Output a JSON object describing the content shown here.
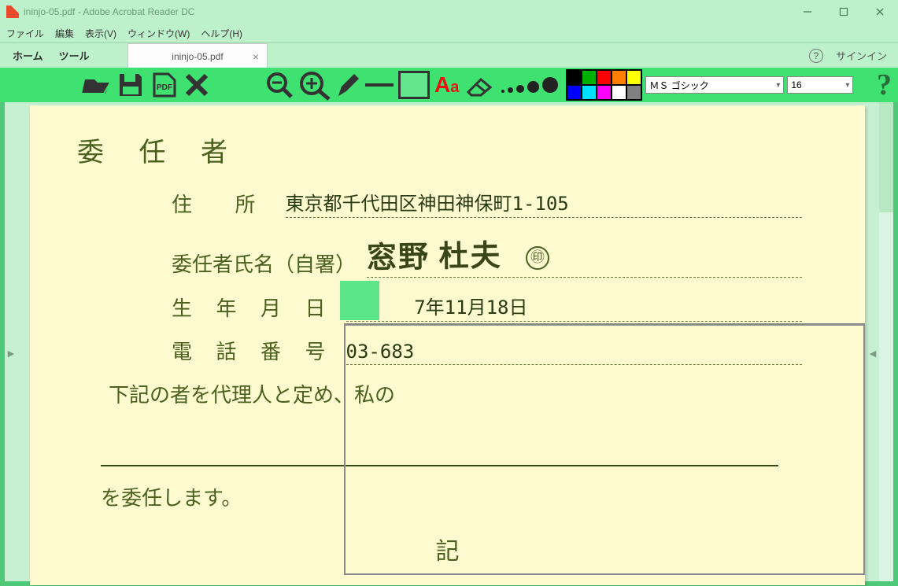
{
  "window": {
    "title": "ininjo-05.pdf - Adobe Acrobat Reader DC"
  },
  "menu": {
    "file": "ファイル",
    "edit": "編集",
    "view": "表示(V)",
    "window": "ウィンドウ(W)",
    "help": "ヘルプ(H)"
  },
  "nav": {
    "home": "ホーム",
    "tools": "ツール"
  },
  "tab": {
    "name": "ininjo-05.pdf"
  },
  "right": {
    "signin": "サインイン",
    "help_glyph": "?"
  },
  "toolbar": {
    "text_aa_big": "A",
    "text_aa_small": "a",
    "palette": [
      "#000000",
      "#ff0000",
      "#ff8000",
      "#ffff00",
      "#808080",
      "#0000ff",
      "#00ffff",
      "#ff00ff",
      "#ffffff",
      "#808080"
    ],
    "font": "ＭＳ ゴシック",
    "size": "16",
    "help_glyph": "?"
  },
  "doc": {
    "heading": "委 任 者",
    "addr_label": "住 所",
    "addr_value": "東京都千代田区神田神保町1-105",
    "name_label": "委任者氏名（自署）",
    "name_value": "窓野 杜夫",
    "seal": "㊞",
    "dob_label": "生 年 月 日",
    "dob_value": "7年11月18日",
    "tel_label": "電 話 番 号",
    "tel_value": "03-683",
    "para1": "下記の者を代理人と定め、私の",
    "para2": "を委任します。",
    "ki": "記"
  }
}
